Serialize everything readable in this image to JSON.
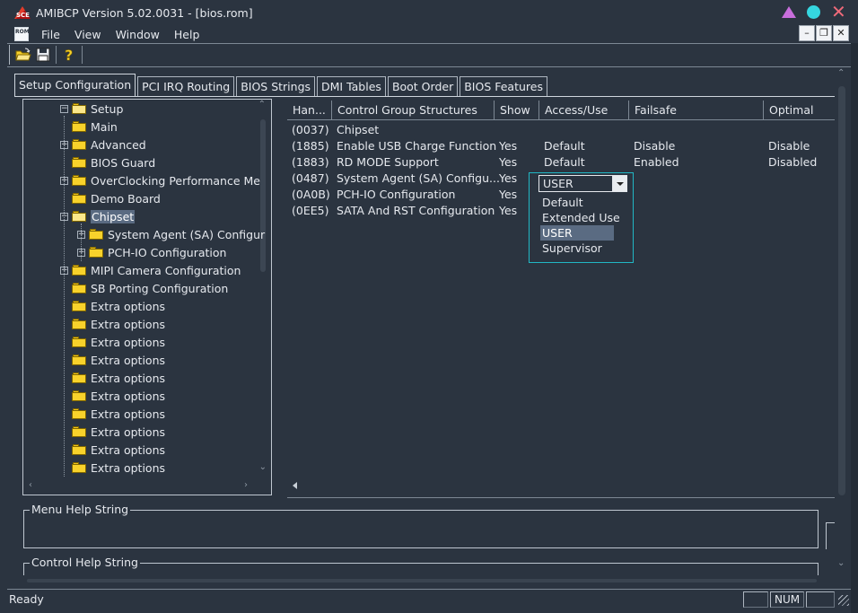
{
  "window": {
    "title": "AMIBCP Version 5.02.0031 - [bios.rom]",
    "app_icon_text": "SCE",
    "doc_icon_text": "ROM"
  },
  "menu": [
    "File",
    "View",
    "Window",
    "Help"
  ],
  "toolbar": {
    "buttons": [
      "open-folder-icon",
      "save-disk-icon",
      "help-question-icon"
    ]
  },
  "tabs": [
    "Setup Configuration",
    "PCI IRQ Routing",
    "BIOS Strings",
    "DMI Tables",
    "Boot Order",
    "BIOS Features"
  ],
  "tree": [
    {
      "label": "Setup",
      "expander": "minus",
      "open": true
    },
    {
      "label": "Main",
      "expander": "none"
    },
    {
      "label": "Advanced",
      "expander": "plus"
    },
    {
      "label": "BIOS Guard",
      "expander": "none"
    },
    {
      "label": "OverClocking Performance Me",
      "expander": "plus"
    },
    {
      "label": "Demo Board",
      "expander": "none"
    },
    {
      "label": "Chipset",
      "expander": "minus",
      "open": true,
      "selected": true
    },
    {
      "label": "System Agent (SA) Configur",
      "expander": "plus"
    },
    {
      "label": "PCH-IO Configuration",
      "expander": "plus"
    },
    {
      "label": "MIPI Camera Configuration",
      "expander": "plus"
    },
    {
      "label": "SB Porting Configuration",
      "expander": "none"
    },
    {
      "label": "Extra options",
      "expander": "none"
    },
    {
      "label": "Extra options",
      "expander": "none"
    },
    {
      "label": "Extra options",
      "expander": "none"
    },
    {
      "label": "Extra options",
      "expander": "none"
    },
    {
      "label": "Extra options",
      "expander": "none"
    },
    {
      "label": "Extra options",
      "expander": "none"
    },
    {
      "label": "Extra options",
      "expander": "none"
    },
    {
      "label": "Extra options",
      "expander": "none"
    },
    {
      "label": "Extra options",
      "expander": "none"
    },
    {
      "label": "Extra options",
      "expander": "none"
    }
  ],
  "grid": {
    "columns": [
      "Han...",
      "Control Group Structures",
      "Show",
      "Access/Use",
      "Failsafe",
      "Optimal"
    ],
    "rows": [
      [
        "(0037)",
        "Chipset",
        "",
        "",
        "",
        ""
      ],
      [
        "(1885)",
        "Enable USB Charge Function",
        "Yes",
        "Default",
        "Disable",
        "Disable"
      ],
      [
        "(1883)",
        "RD MODE Support",
        "Yes",
        "Default",
        "Enabled",
        "Disabled"
      ],
      [
        "(0487)",
        "System Agent (SA) Configu...",
        "Yes",
        "",
        "",
        ""
      ],
      [
        "(0A0B)",
        "PCH-IO Configuration",
        "Yes",
        "",
        "",
        ""
      ],
      [
        "(0EE5)",
        "SATA And RST Configuration",
        "Yes",
        "",
        "",
        ""
      ]
    ]
  },
  "access_dropdown": {
    "value": "USER",
    "options": [
      "Default",
      "Extended Use",
      "USER",
      "Supervisor"
    ],
    "highlighted": "USER"
  },
  "help": {
    "menu_help_label": "Menu Help String",
    "control_help_label": "Control Help String"
  },
  "status": {
    "text": "Ready",
    "num": "NUM"
  },
  "colors": {
    "background": "#2b3440",
    "selection": "#5a6b82",
    "dropdown_border": "#21b7c4",
    "folder": "#f8d22b"
  }
}
